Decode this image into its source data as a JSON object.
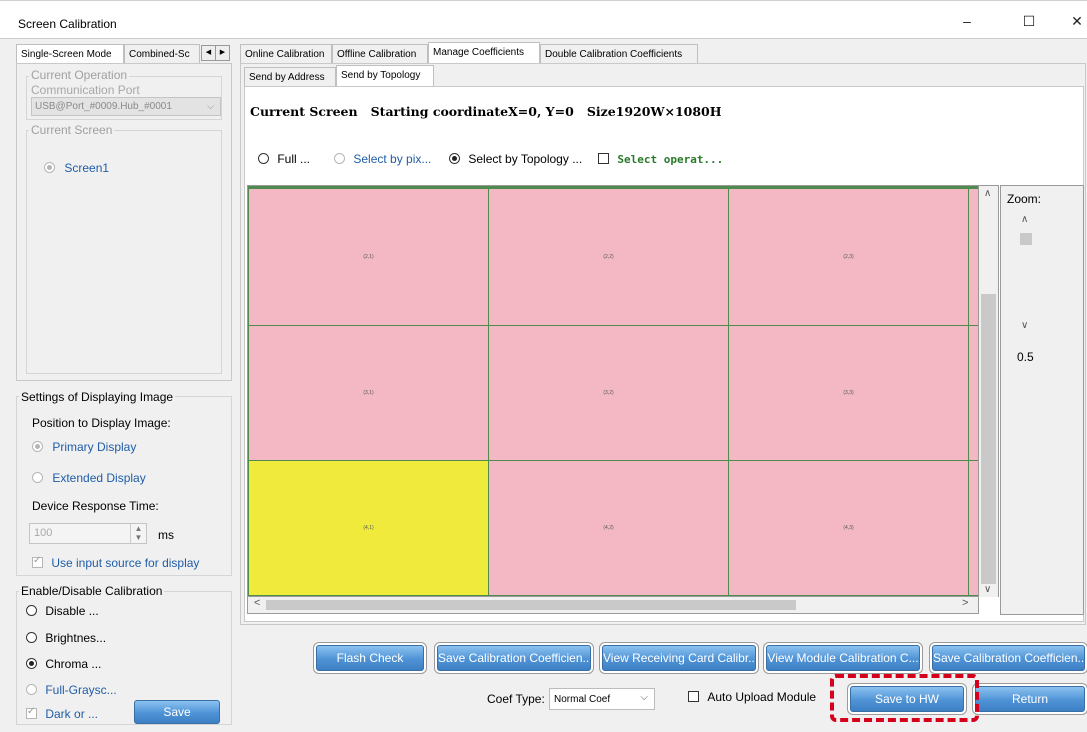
{
  "window": {
    "title": "Screen Calibration",
    "minimize": "–",
    "maximize": "☐",
    "close": "✕"
  },
  "left_tabs": [
    "Single-Screen Mode",
    "Combined-Sc"
  ],
  "current_operation": {
    "legend": "Current Operation",
    "port_label": "Communication Port",
    "port_value": "USB@Port_#0009.Hub_#0001"
  },
  "current_screen": {
    "legend": "Current Screen",
    "screen": "Screen1"
  },
  "display_settings": {
    "legend": "Settings of Displaying Image",
    "position_label": "Position to Display Image:",
    "primary": "Primary Display",
    "extended": "Extended Display",
    "response_label": "Device Response Time:",
    "response_value": "100",
    "unit": "ms",
    "input_source": "Use input source for display"
  },
  "calibration_toggle": {
    "legend": "Enable/Disable Calibration",
    "options": [
      "Disable ...",
      "Brightnes...",
      "Chroma ...",
      "Full-Graysc..."
    ],
    "dark": "Dark or ...",
    "save": "Save"
  },
  "top_tabs": [
    "Online Calibration",
    "Offline Calibration",
    "Manage Coefficients",
    "Double Calibration Coefficients"
  ],
  "sub_tabs": [
    "Send by Address",
    "Send by Topology"
  ],
  "screen_info": "Current Screen   Starting coordinateX=0, Y=0   Size1920W×1080H",
  "selection_modes": {
    "full": "Full ...",
    "pixel": "Select by pix...",
    "topology": "Select by Topology ...",
    "operate": "Select operat..."
  },
  "grid": {
    "rows": [
      [
        "(2,1)",
        "(2,2)",
        "(2,3)"
      ],
      [
        "(3,1)",
        "(3,2)",
        "(3,3)"
      ],
      [
        "(4,1)",
        "(4,2)",
        "(4,3)"
      ]
    ],
    "selected_cell": "(4,1)"
  },
  "zoom": {
    "label": "Zoom:",
    "value": "0.5"
  },
  "bottom_buttons": [
    "Flash Check",
    "Save Calibration Coefficien...",
    "View Receiving Card Calibr...",
    "View Module Calibration C...",
    "Save Calibration Coefficien..."
  ],
  "coef": {
    "label": "Coef Type:",
    "value": "Normal Coef"
  },
  "auto_upload": "Auto Upload Module",
  "save_hw": "Save to HW",
  "return": "Return",
  "colors": {
    "cell": "#f4b8c4",
    "selected_cell": "#f0ea3c",
    "highlight": "#d6001c",
    "button": "#4f93d6"
  }
}
